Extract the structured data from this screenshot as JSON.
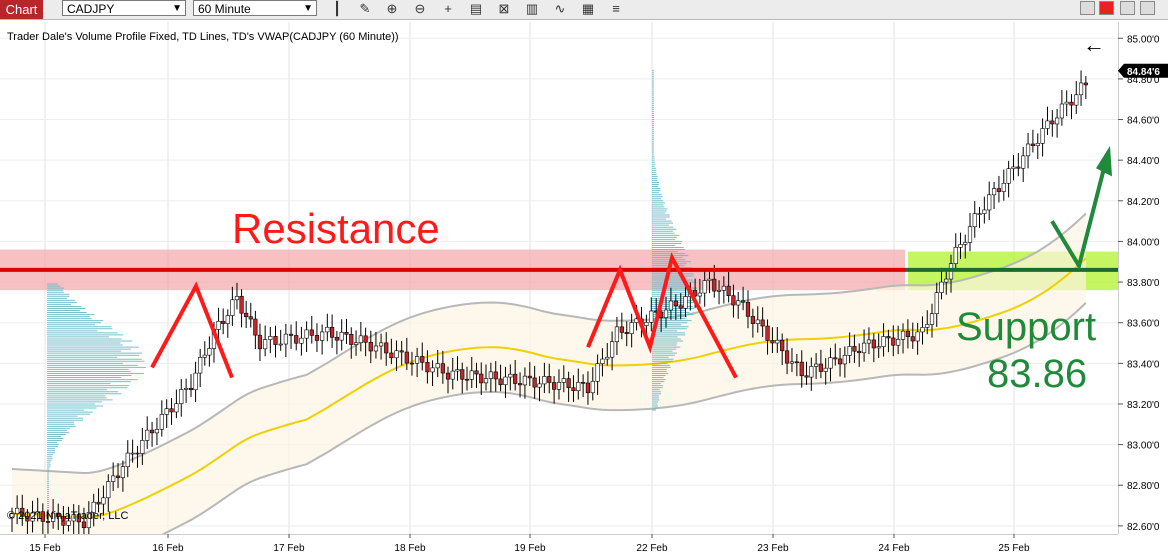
{
  "toolbar": {
    "tab_label": "Chart",
    "instrument": "CADJPY",
    "interval": "60 Minute",
    "tools": [
      "bar-style-icon",
      "pencil-icon",
      "zoom-in-icon",
      "zoom-out-icon",
      "crosshair-icon",
      "data-box-icon",
      "indicators-icon",
      "strategies-icon",
      "drawing-tools-icon",
      "properties-icon"
    ]
  },
  "chart_title": "Trader Dale's Volume Profile Fixed, TD Lines, TD's VWAP(CADJPY (60 Minute))",
  "copyright": "© 2021 NinjaTrader, LLC",
  "annotations": {
    "resistance": "Resistance",
    "support_line1": "Support",
    "support_line2": "83.86"
  },
  "colors": {
    "resistance_text": "#ff1a1a",
    "resistance_line": "#e00000",
    "resistance_band": "#f4a6aa",
    "support_text": "#1e8a3a",
    "support_line": "#1c6b2e",
    "support_zone": "#b6f238",
    "vwap": "#f0d000",
    "band": "#b8b8b8",
    "profile": "#5fb6c4",
    "candle_up": "#ffffff",
    "candle_down": "#c0282a"
  },
  "chart_data": {
    "type": "candlestick",
    "title": "Trader Dale's Volume Profile Fixed, TD Lines, TD's VWAP(CADJPY (60 Minute))",
    "x_ticks": [
      "15 Feb",
      "16 Feb",
      "17 Feb",
      "18 Feb",
      "19 Feb",
      "22 Feb",
      "23 Feb",
      "24 Feb",
      "25 Feb"
    ],
    "y_ticks": [
      "82.60'0",
      "82.80'0",
      "83.00'0",
      "83.20'0",
      "83.40'0",
      "83.60'0",
      "83.80'0",
      "84.00'0",
      "84.20'0",
      "84.40'0",
      "84.60'0",
      "84.80'0",
      "85.00'0"
    ],
    "ylim": [
      82.56,
      85.08
    ],
    "last_price": "84.84'6",
    "close_path": [
      [
        "15 Feb",
        82.62
      ],
      [
        "15 Feb",
        82.9
      ],
      [
        "16 Feb",
        83.3
      ],
      [
        "16 Feb",
        83.55
      ],
      [
        "16 Feb",
        83.72
      ],
      [
        "16 Feb",
        83.5
      ],
      [
        "17 Feb",
        83.55
      ],
      [
        "17 Feb",
        83.5
      ],
      [
        "18 Feb",
        83.35
      ],
      [
        "18 Feb",
        83.33
      ],
      [
        "19 Feb",
        83.3
      ],
      [
        "19 Feb",
        83.28
      ],
      [
        "19 Feb",
        83.55
      ],
      [
        "22 Feb",
        83.7
      ],
      [
        "22 Feb",
        83.8
      ],
      [
        "22 Feb",
        83.7
      ],
      [
        "23 Feb",
        83.35
      ],
      [
        "23 Feb",
        83.4
      ],
      [
        "23 Feb",
        83.48
      ],
      [
        "24 Feb",
        83.55
      ],
      [
        "24 Feb",
        83.9
      ],
      [
        "24 Feb",
        84.15
      ],
      [
        "25 Feb",
        84.6
      ],
      [
        "25 Feb",
        84.8
      ]
    ],
    "levels": {
      "resistance": 83.86,
      "support": 83.86
    }
  }
}
